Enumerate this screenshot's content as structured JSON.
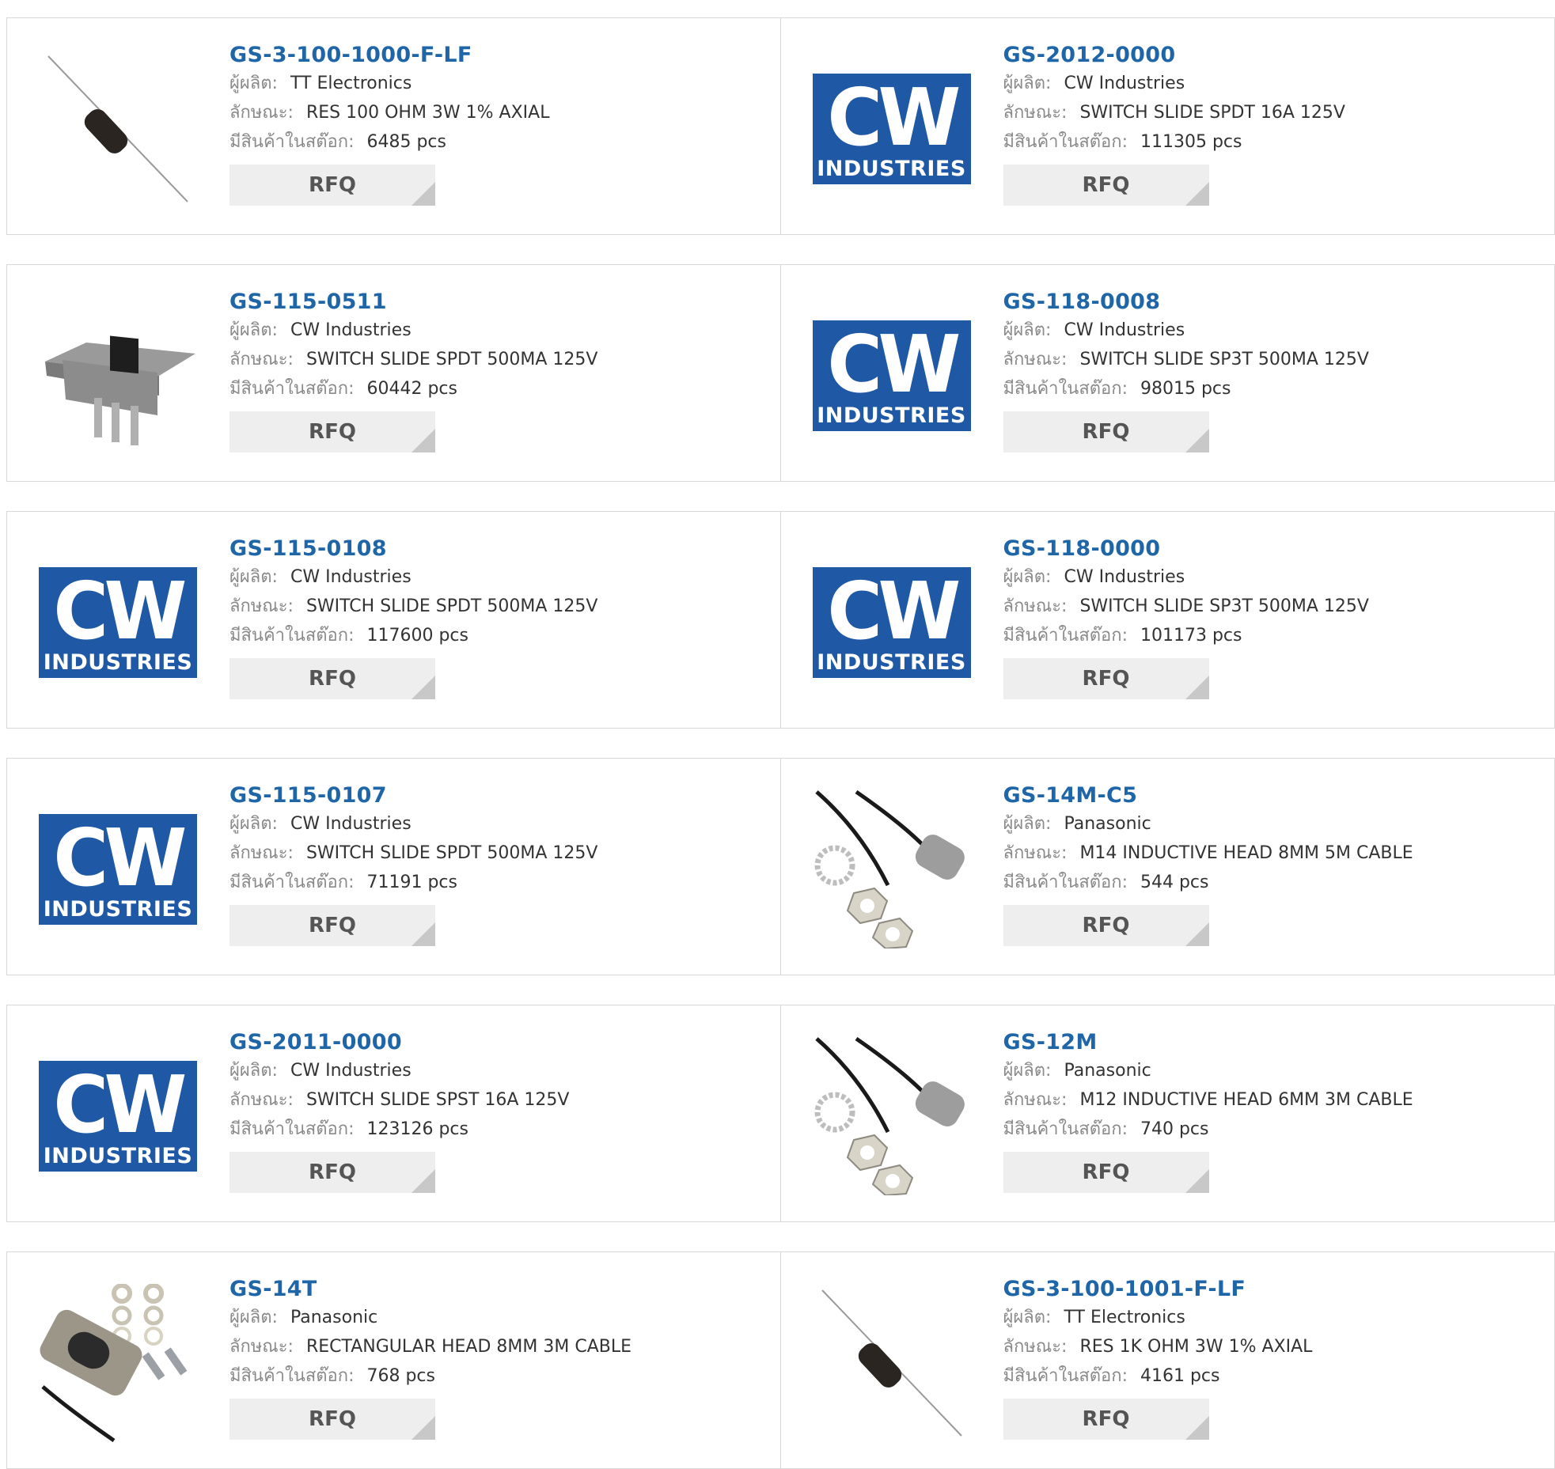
{
  "labels": {
    "manufacturer": "ผู้ผลิต:",
    "description": "ลักษณะ:",
    "stock": "มีสินค้าในสต๊อก:",
    "rfq": "RFQ"
  },
  "logo": {
    "cw_text": "CW",
    "industries_text": "INDUSTRIES"
  },
  "products": [
    {
      "part": "GS-3-100-1000-F-LF",
      "manufacturer": "TT Electronics",
      "description": "RES 100 OHM 3W 1% AXIAL",
      "stock": "6485 pcs",
      "image": "resistor-image"
    },
    {
      "part": "GS-2012-0000",
      "manufacturer": "CW Industries",
      "description": "SWITCH SLIDE SPDT 16A 125V",
      "stock": "111305 pcs",
      "image": "cw-logo"
    },
    {
      "part": "GS-115-0511",
      "manufacturer": "CW Industries",
      "description": "SWITCH SLIDE SPDT 500MA 125V",
      "stock": "60442 pcs",
      "image": "slide-switch-image"
    },
    {
      "part": "GS-118-0008",
      "manufacturer": "CW Industries",
      "description": "SWITCH SLIDE SP3T 500MA 125V",
      "stock": "98015 pcs",
      "image": "cw-logo"
    },
    {
      "part": "GS-115-0108",
      "manufacturer": "CW Industries",
      "description": "SWITCH SLIDE SPDT 500MA 125V",
      "stock": "117600 pcs",
      "image": "cw-logo"
    },
    {
      "part": "GS-118-0000",
      "manufacturer": "CW Industries",
      "description": "SWITCH SLIDE SP3T 500MA 125V",
      "stock": "101173 pcs",
      "image": "cw-logo"
    },
    {
      "part": "GS-115-0107",
      "manufacturer": "CW Industries",
      "description": "SWITCH SLIDE SPDT 500MA 125V",
      "stock": "71191 pcs",
      "image": "cw-logo"
    },
    {
      "part": "GS-14M-C5",
      "manufacturer": "Panasonic",
      "description": "M14 INDUCTIVE HEAD 8MM 5M CABLE",
      "stock": "544 pcs",
      "image": "inductive-sensor-image"
    },
    {
      "part": "GS-2011-0000",
      "manufacturer": "CW Industries",
      "description": "SWITCH SLIDE SPST 16A 125V",
      "stock": "123126 pcs",
      "image": "cw-logo"
    },
    {
      "part": "GS-12M",
      "manufacturer": "Panasonic",
      "description": "M12 INDUCTIVE HEAD 6MM 3M CABLE",
      "stock": "740 pcs",
      "image": "inductive-sensor-image"
    },
    {
      "part": "GS-14T",
      "manufacturer": "Panasonic",
      "description": "RECTANGULAR HEAD 8MM 3M CABLE",
      "stock": "768 pcs",
      "image": "rectangular-sensor-image"
    },
    {
      "part": "GS-3-100-1001-F-LF",
      "manufacturer": "TT Electronics",
      "description": "RES 1K OHM 3W 1% AXIAL",
      "stock": "4161 pcs",
      "image": "resistor-image"
    }
  ]
}
